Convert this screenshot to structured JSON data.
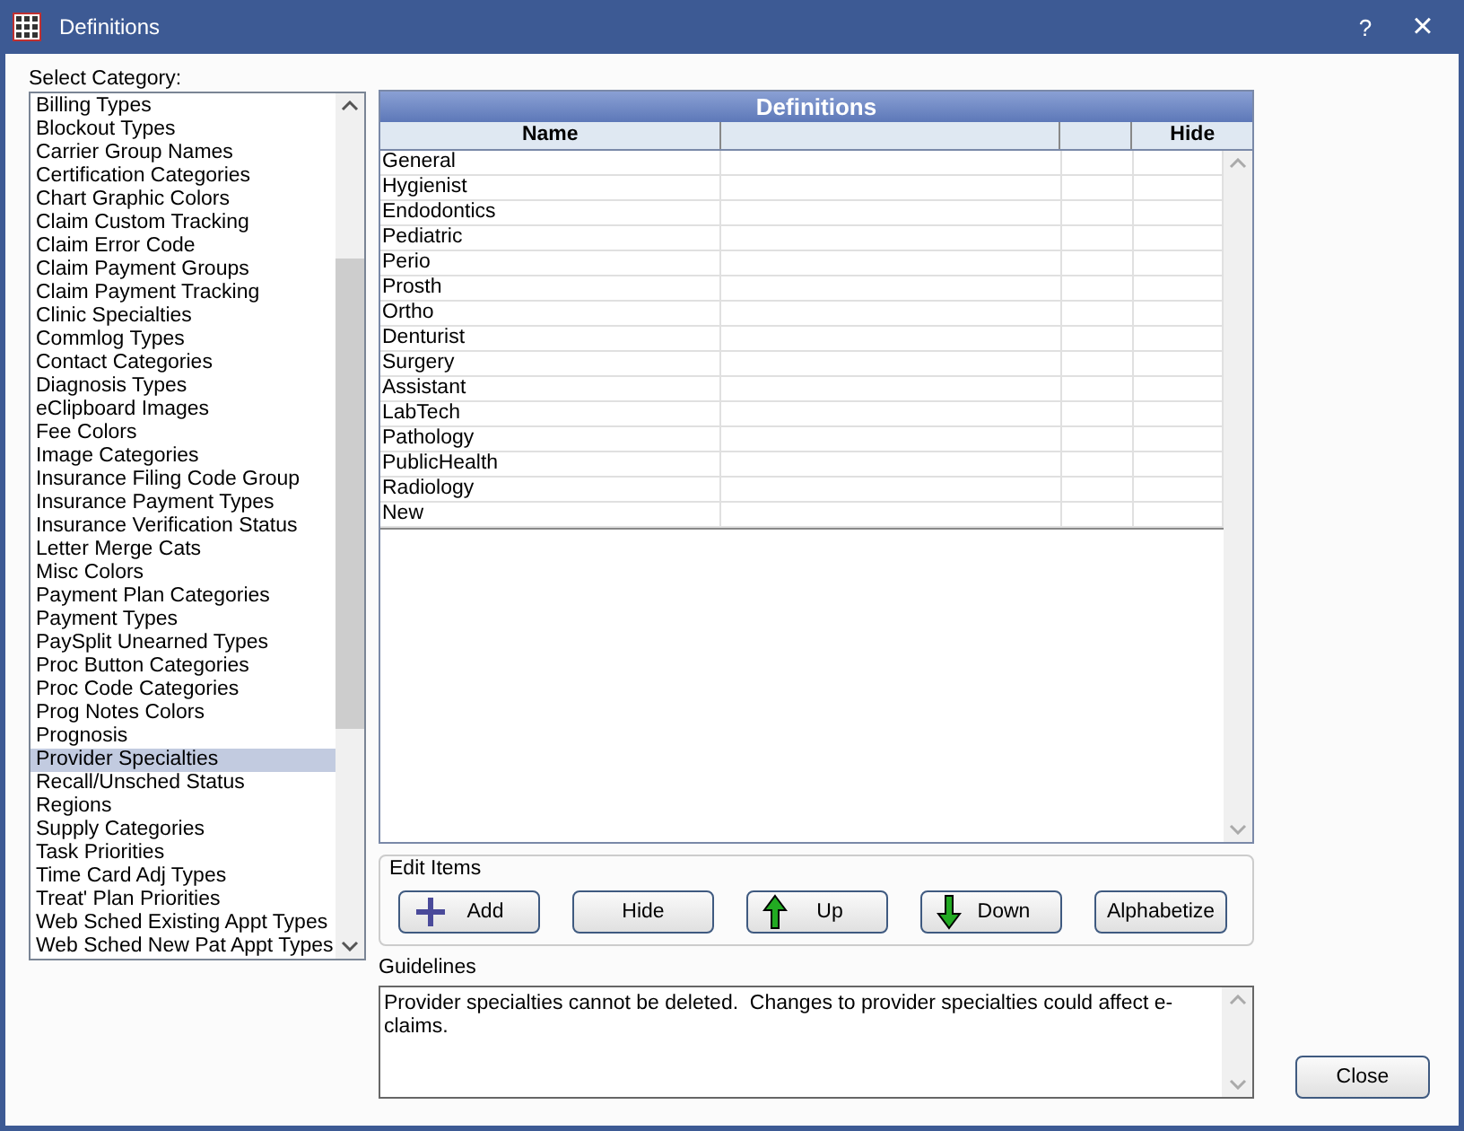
{
  "window": {
    "title": "Definitions",
    "help": "?",
    "close": "×"
  },
  "category_label": "Select Category:",
  "categories": [
    {
      "label": "Billing Types",
      "selected": false
    },
    {
      "label": "Blockout Types",
      "selected": false
    },
    {
      "label": "Carrier Group Names",
      "selected": false
    },
    {
      "label": "Certification Categories",
      "selected": false
    },
    {
      "label": "Chart Graphic Colors",
      "selected": false
    },
    {
      "label": "Claim Custom Tracking",
      "selected": false
    },
    {
      "label": "Claim Error Code",
      "selected": false
    },
    {
      "label": "Claim Payment Groups",
      "selected": false
    },
    {
      "label": "Claim Payment Tracking",
      "selected": false
    },
    {
      "label": "Clinic Specialties",
      "selected": false
    },
    {
      "label": "Commlog Types",
      "selected": false
    },
    {
      "label": "Contact Categories",
      "selected": false
    },
    {
      "label": "Diagnosis Types",
      "selected": false
    },
    {
      "label": "eClipboard Images",
      "selected": false
    },
    {
      "label": "Fee Colors",
      "selected": false
    },
    {
      "label": "Image Categories",
      "selected": false
    },
    {
      "label": "Insurance Filing Code Group",
      "selected": false
    },
    {
      "label": "Insurance Payment Types",
      "selected": false
    },
    {
      "label": "Insurance Verification Status",
      "selected": false
    },
    {
      "label": "Letter Merge Cats",
      "selected": false
    },
    {
      "label": "Misc Colors",
      "selected": false
    },
    {
      "label": "Payment Plan Categories",
      "selected": false
    },
    {
      "label": "Payment Types",
      "selected": false
    },
    {
      "label": "PaySplit Unearned Types",
      "selected": false
    },
    {
      "label": "Proc Button Categories",
      "selected": false
    },
    {
      "label": "Proc Code Categories",
      "selected": false
    },
    {
      "label": "Prog Notes Colors",
      "selected": false
    },
    {
      "label": "Prognosis",
      "selected": false
    },
    {
      "label": "Provider Specialties",
      "selected": true
    },
    {
      "label": "Recall/Unsched Status",
      "selected": false
    },
    {
      "label": "Regions",
      "selected": false
    },
    {
      "label": "Supply Categories",
      "selected": false
    },
    {
      "label": "Task Priorities",
      "selected": false
    },
    {
      "label": "Time Card Adj Types",
      "selected": false
    },
    {
      "label": "Treat' Plan Priorities",
      "selected": false
    },
    {
      "label": "Web Sched Existing Appt Types",
      "selected": false
    },
    {
      "label": "Web Sched New Pat Appt Types",
      "selected": false
    }
  ],
  "grid": {
    "title": "Definitions",
    "columns": {
      "name": "Name",
      "hide": "Hide"
    },
    "rows": [
      "General",
      "Hygienist",
      "Endodontics",
      "Pediatric",
      "Perio",
      "Prosth",
      "Ortho",
      "Denturist",
      "Surgery",
      "Assistant",
      "LabTech",
      "Pathology",
      "PublicHealth",
      "Radiology",
      "New"
    ]
  },
  "edit_items": {
    "label": "Edit Items",
    "buttons": [
      {
        "label": "Add",
        "kind": "plus"
      },
      {
        "label": "Hide",
        "kind": "plain"
      },
      {
        "label": "Up",
        "kind": "up"
      },
      {
        "label": "Down",
        "kind": "down"
      },
      {
        "label": "Alphabetize",
        "kind": "plain"
      }
    ]
  },
  "guidelines": {
    "label": "Guidelines",
    "text": "Provider specialties cannot be deleted.  Changes to provider specialties could affect e-claims."
  },
  "close_button": "Close"
}
